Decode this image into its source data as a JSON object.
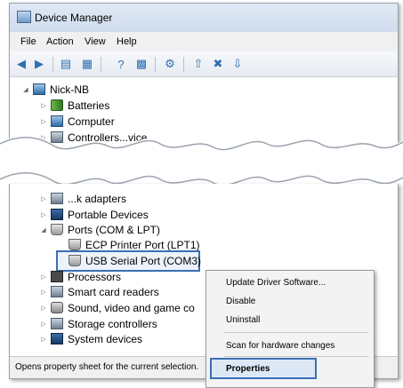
{
  "window": {
    "title": "Device Manager"
  },
  "menu": [
    "File",
    "Action",
    "View",
    "Help"
  ],
  "toolbar_icons": [
    "back-icon",
    "forward-icon",
    "show-hide-console-tree-icon",
    "properties-icon",
    "help-icon",
    "action-pane-icon",
    "scan-hardware-icon",
    "update-driver-icon",
    "uninstall-icon",
    "disable-icon"
  ],
  "tree_top": [
    {
      "label": "Nick-NB",
      "icon": "computer-icon",
      "expanded": true
    },
    {
      "label": "Batteries",
      "icon": "battery-icon"
    },
    {
      "label": "Computer",
      "icon": "computer-icon"
    },
    {
      "label": "Controllers...vice",
      "icon": "controller-icon"
    }
  ],
  "tree_bottom": [
    {
      "label": "...k adapters",
      "icon": "network-icon"
    },
    {
      "label": "Portable Devices",
      "icon": "portable-device-icon"
    },
    {
      "label": "Ports (COM & LPT)",
      "icon": "port-icon",
      "expanded": true
    },
    {
      "label": "ECP Printer Port (LPT1)",
      "icon": "port-icon",
      "child": true
    },
    {
      "label": "USB Serial Port (COM3)",
      "icon": "port-icon",
      "child": true,
      "selected": true
    },
    {
      "label": "Processors",
      "icon": "processor-icon"
    },
    {
      "label": "Smart card readers",
      "icon": "smart-card-icon"
    },
    {
      "label": "Sound, video and game co",
      "icon": "sound-icon"
    },
    {
      "label": "Storage controllers",
      "icon": "storage-icon"
    },
    {
      "label": "System devices",
      "icon": "system-icon"
    }
  ],
  "status_bar": "Opens property sheet for the current selection.",
  "context_menu": {
    "items": [
      "Update Driver Software...",
      "Disable",
      "Uninstall",
      "Scan for hardware changes"
    ],
    "highlighted": "Properties"
  },
  "colors": {
    "highlight_border": "#3b6fb3",
    "title_gradient": "#dfe9f5"
  }
}
